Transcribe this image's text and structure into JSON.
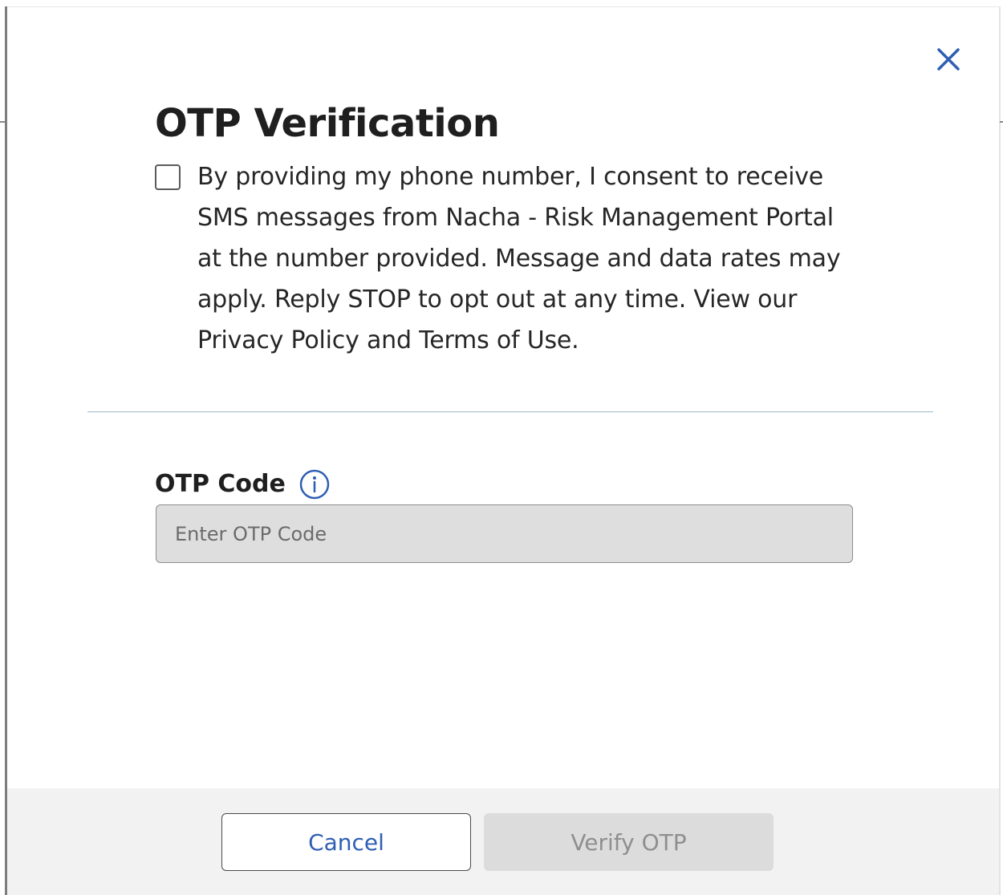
{
  "modal": {
    "title": "OTP Verification",
    "close_icon": "close-icon"
  },
  "consent": {
    "checked": false,
    "text": "By providing my phone number, I consent to receive SMS messages from Nacha - Risk Management Portal at the number provided. Message and data rates may apply. Reply STOP to opt out at any time. View our Privacy Policy and Terms of Use."
  },
  "otp": {
    "label": "OTP Code",
    "info_icon": "info-icon",
    "placeholder": "Enter OTP Code",
    "value": ""
  },
  "footer": {
    "cancel_label": "Cancel",
    "verify_label": "Verify OTP",
    "verify_enabled": false
  },
  "colors": {
    "accent": "#2f5fb3",
    "divider": "#9fb7c9",
    "disabled_bg": "#dcdcdc",
    "disabled_text": "#8f8f8f"
  }
}
